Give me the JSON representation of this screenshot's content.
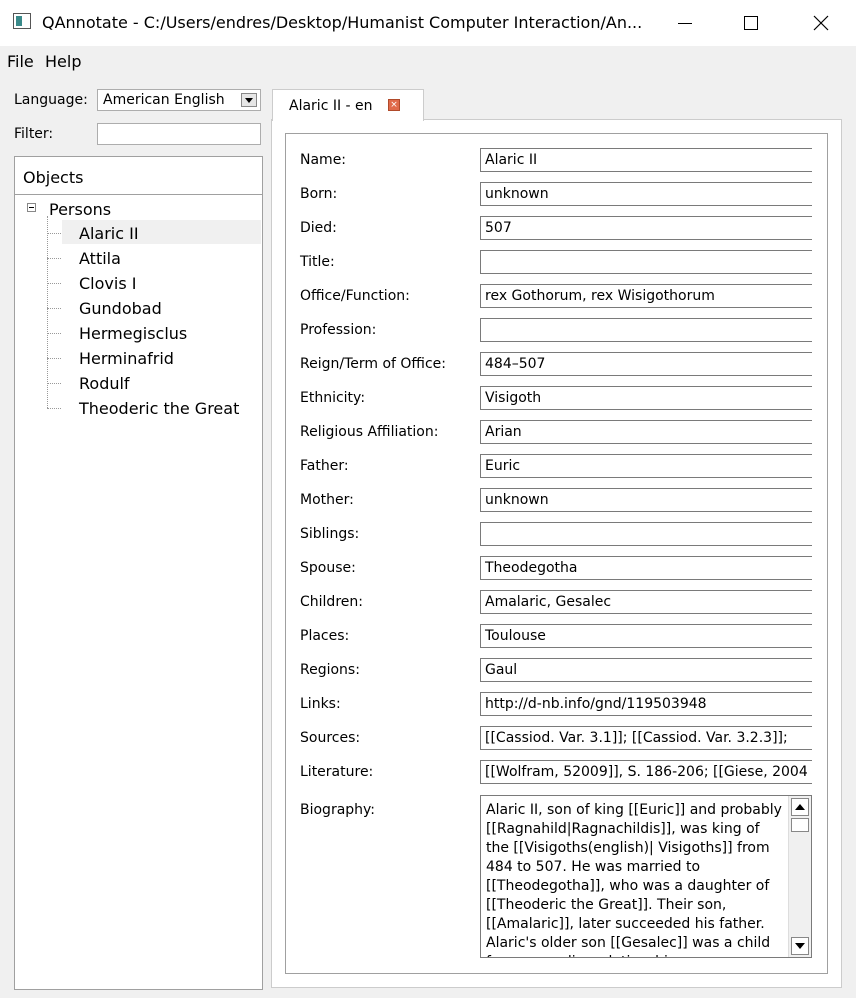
{
  "window": {
    "title": "QAnnotate - C:/Users/endres/Desktop/Humanist Computer Interaction/An..."
  },
  "menu": {
    "file": "File",
    "help": "Help"
  },
  "sidebar": {
    "language_label": "Language:",
    "language_value": "American English",
    "filter_label": "Filter:",
    "filter_value": "",
    "objects_header": "Objects",
    "root": "Persons",
    "items": [
      "Alaric II",
      "Attila",
      "Clovis I",
      "Gundobad",
      "Hermegisclus",
      "Herminafrid",
      "Rodulf",
      "Theoderic the Great"
    ],
    "selected": "Alaric II"
  },
  "tab": {
    "label": "Alaric II - en"
  },
  "form": {
    "fields": [
      {
        "label": "Name:",
        "value": "Alaric II"
      },
      {
        "label": "Born:",
        "value": "unknown"
      },
      {
        "label": "Died:",
        "value": "507"
      },
      {
        "label": "Title:",
        "value": ""
      },
      {
        "label": "Office/Function:",
        "value": "rex Gothorum, rex Wisigothorum"
      },
      {
        "label": "Profession:",
        "value": ""
      },
      {
        "label": "Reign/Term of Office:",
        "value": "484–507"
      },
      {
        "label": "Ethnicity:",
        "value": "Visigoth"
      },
      {
        "label": "Religious Affiliation:",
        "value": "Arian"
      },
      {
        "label": "Father:",
        "value": "Euric"
      },
      {
        "label": "Mother:",
        "value": "unknown"
      },
      {
        "label": "Siblings:",
        "value": ""
      },
      {
        "label": "Spouse:",
        "value": "Theodegotha"
      },
      {
        "label": "Children:",
        "value": "Amalaric, Gesalec"
      },
      {
        "label": "Places:",
        "value": "Toulouse"
      },
      {
        "label": "Regions:",
        "value": "Gaul"
      },
      {
        "label": "Links:",
        "value": "http://d-nb.info/gnd/119503948"
      },
      {
        "label": "Sources:",
        "value": "[[Cassiod. Var. 3.1]]; [[Cassiod. Var. 3.2.3]];"
      },
      {
        "label": "Literature:",
        "value": "[[Wolfram, 52009]], S. 186-206; [[Giese, 2004"
      }
    ],
    "biography_label": "Biography:",
    "biography": "Alaric II, son of king [[Euric]] and probably [[Ragnahild|Ragnachildis]], was king of the [[Visigoths(english)| Visigoths]] from 484 to 507. He was married to [[Theodegotha]], who was a daughter of [[Theoderic the Great]]. Their son, [[Amalaric]], later succeeded his father. Alaric's older son [[Gesalec]] was a child from an earlier relationship."
  }
}
